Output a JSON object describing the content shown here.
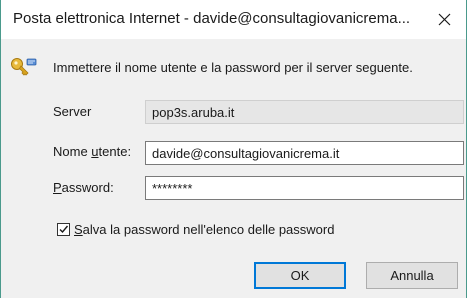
{
  "window": {
    "title": "Posta elettronica Internet - davide@consultagiovanicrema...",
    "close_glyph": "close-icon"
  },
  "dialog": {
    "icon": "key-icon",
    "message": "Immettere il nome utente e la password per il server seguente.",
    "server": {
      "label": "Server",
      "value": "pop3s.aruba.it"
    },
    "username": {
      "label_pre": "Nome ",
      "label_ul": "u",
      "label_post": "tente:",
      "value": "davide@consultagiovanicrema.it"
    },
    "password": {
      "label_ul": "P",
      "label_post": "assword:",
      "value": "********"
    },
    "save_password": {
      "label_ul": "S",
      "label_post": "alva la password nell'elenco delle password",
      "checked": true
    },
    "ok_label": "OK",
    "cancel_label": "Annulla"
  },
  "colors": {
    "accent": "#0078d7",
    "border": "#4a9a8c"
  }
}
